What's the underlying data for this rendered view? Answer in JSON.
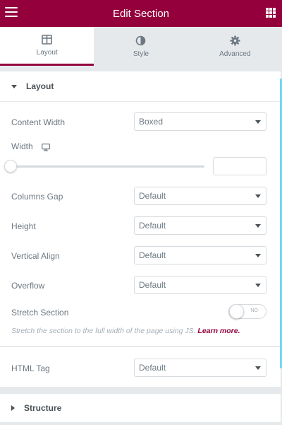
{
  "header": {
    "title": "Edit Section",
    "menu_icon": "hamburger-icon",
    "apps_icon": "grid-icon",
    "brand_color": "#93003c"
  },
  "tabs": [
    {
      "label": "Layout",
      "icon": "layout-icon",
      "active": true
    },
    {
      "label": "Style",
      "icon": "half-circle-icon",
      "active": false
    },
    {
      "label": "Advanced",
      "icon": "gear-icon",
      "active": false
    }
  ],
  "layout_section": {
    "title": "Layout",
    "content_width": {
      "label": "Content Width",
      "value": "Boxed"
    },
    "width": {
      "label": "Width",
      "device_icon": "desktop-icon",
      "value": "",
      "slider_level": 0
    },
    "columns_gap": {
      "label": "Columns Gap",
      "value": "Default"
    },
    "height": {
      "label": "Height",
      "value": "Default"
    },
    "vertical_align": {
      "label": "Vertical Align",
      "value": "Default"
    },
    "overflow": {
      "label": "Overflow",
      "value": "Default"
    },
    "stretch_section": {
      "label": "Stretch Section",
      "toggle_text": "NO",
      "enabled": false
    },
    "help_text": "Stretch the section to the full width of the page using JS.",
    "learn_more": "Learn more.",
    "html_tag": {
      "label": "HTML Tag",
      "value": "Default"
    }
  },
  "structure_section": {
    "title": "Structure"
  }
}
